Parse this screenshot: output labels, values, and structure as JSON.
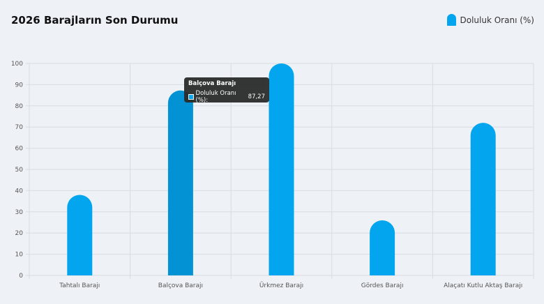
{
  "page": {
    "title": "2026 Barajların Son Durumu"
  },
  "legend": {
    "label": "Doluluk Oranı (%)"
  },
  "tooltip": {
    "title": "Balçova Barajı",
    "series_label": "Doluluk Oranı (%):",
    "value": "87,27"
  },
  "colors": {
    "bar": "#03a6ee",
    "bar_hover": "#0392d4",
    "grid": "#d8dde3",
    "background": "#eef1f5"
  },
  "chart_data": {
    "type": "bar",
    "categories": [
      "Tahtalı Barajı",
      "Balçova Barajı",
      "Ürkmez Barajı",
      "Gördes Barajı",
      "Alaçatı Kutlu Aktaş Barajı"
    ],
    "series": [
      {
        "name": "Doluluk Oranı (%)",
        "values": [
          38,
          87.27,
          100,
          26,
          72
        ]
      }
    ],
    "y_ticks": [
      "0",
      "10",
      "20",
      "30",
      "40",
      "50",
      "60",
      "70",
      "80",
      "90",
      "100"
    ],
    "ylim": [
      0,
      100
    ],
    "grid": true,
    "legend_position": "top-right",
    "highlighted_category": "Balçova Barajı"
  }
}
